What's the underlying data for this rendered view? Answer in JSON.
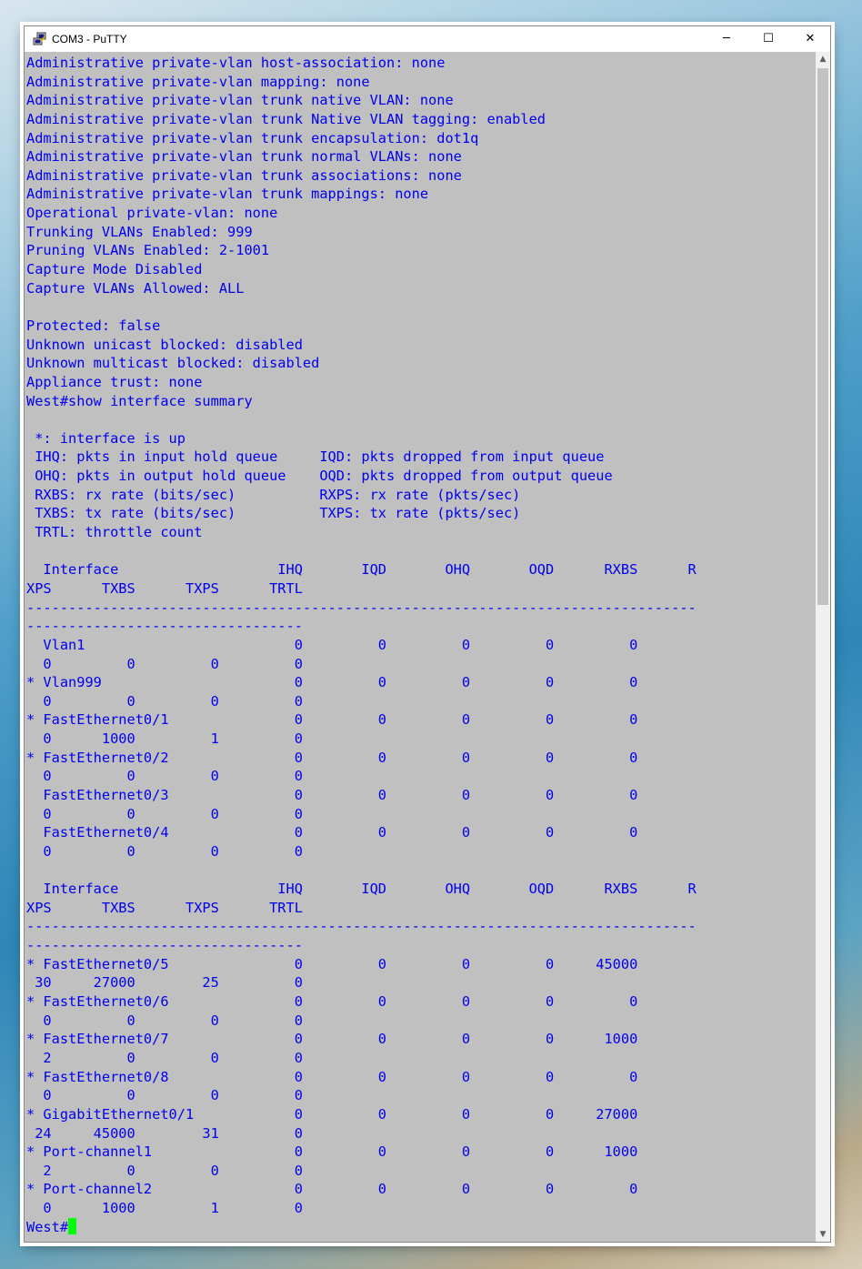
{
  "window": {
    "title": "COM3 - PuTTY",
    "controls": {
      "minimize": "─",
      "maximize": "☐",
      "close": "✕"
    },
    "icon": "putty-icon"
  },
  "terminal": {
    "text_color": "#0000ee",
    "background": "#c0c0c0",
    "cursor_color": "#00ff00",
    "lines": [
      "Administrative private-vlan host-association: none",
      "Administrative private-vlan mapping: none",
      "Administrative private-vlan trunk native VLAN: none",
      "Administrative private-vlan trunk Native VLAN tagging: enabled",
      "Administrative private-vlan trunk encapsulation: dot1q",
      "Administrative private-vlan trunk normal VLANs: none",
      "Administrative private-vlan trunk associations: none",
      "Administrative private-vlan trunk mappings: none",
      "Operational private-vlan: none",
      "Trunking VLANs Enabled: 999",
      "Pruning VLANs Enabled: 2-1001",
      "Capture Mode Disabled",
      "Capture VLANs Allowed: ALL",
      "",
      "Protected: false",
      "Unknown unicast blocked: disabled",
      "Unknown multicast blocked: disabled",
      "Appliance trust: none",
      "West#show interface summary",
      "",
      " *: interface is up",
      " IHQ: pkts in input hold queue     IQD: pkts dropped from input queue",
      " OHQ: pkts in output hold queue    OQD: pkts dropped from output queue",
      " RXBS: rx rate (bits/sec)          RXPS: rx rate (pkts/sec)",
      " TXBS: tx rate (bits/sec)          TXPS: tx rate (pkts/sec)",
      " TRTL: throttle count",
      "",
      "  Interface                   IHQ       IQD       OHQ       OQD      RXBS      R",
      "XPS      TXBS      TXPS      TRTL",
      "--------------------------------------------------------------------------------",
      "---------------------------------",
      "  Vlan1                         0         0         0         0         0",
      "  0         0         0         0",
      "* Vlan999                       0         0         0         0         0",
      "  0         0         0         0",
      "* FastEthernet0/1               0         0         0         0         0",
      "  0      1000         1         0",
      "* FastEthernet0/2               0         0         0         0         0",
      "  0         0         0         0",
      "  FastEthernet0/3               0         0         0         0         0",
      "  0         0         0         0",
      "  FastEthernet0/4               0         0         0         0         0",
      "  0         0         0         0",
      "",
      "  Interface                   IHQ       IQD       OHQ       OQD      RXBS      R",
      "XPS      TXBS      TXPS      TRTL",
      "--------------------------------------------------------------------------------",
      "---------------------------------",
      "* FastEthernet0/5               0         0         0         0     45000",
      " 30     27000        25         0",
      "* FastEthernet0/6               0         0         0         0         0",
      "  0         0         0         0",
      "* FastEthernet0/7               0         0         0         0      1000",
      "  2         0         0         0",
      "* FastEthernet0/8               0         0         0         0         0",
      "  0         0         0         0",
      "* GigabitEthernet0/1            0         0         0         0     27000",
      " 24     45000        31         0",
      "* Port-channel1                 0         0         0         0      1000",
      "  2         0         0         0",
      "* Port-channel2                 0         0         0         0         0",
      "  0      1000         1         0"
    ],
    "prompt": "West#"
  }
}
